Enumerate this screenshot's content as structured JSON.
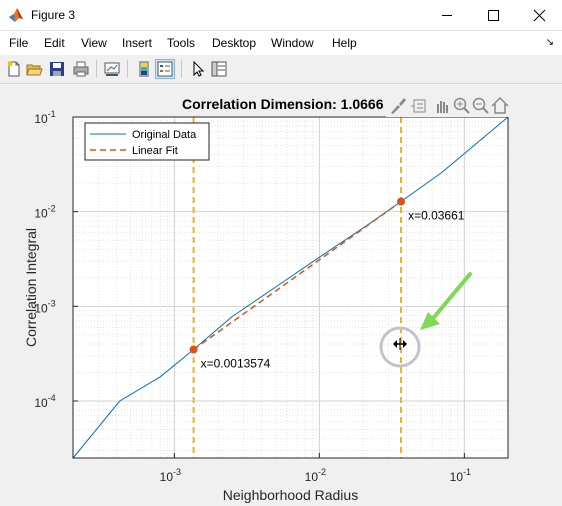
{
  "window": {
    "title": "Figure 3"
  },
  "menu": [
    "File",
    "Edit",
    "View",
    "Insert",
    "Tools",
    "Desktop",
    "Window",
    "Help"
  ],
  "toolbar": {
    "buttons": [
      "new-figure-icon",
      "open-file-icon",
      "save-icon",
      "print-icon",
      "link-plot-icon",
      "insert-colorbar-icon",
      "insert-legend-icon",
      "edit-plot-arrow-icon",
      "property-inspector-icon"
    ]
  },
  "axes_toolbar": [
    "brush-icon",
    "data-tips-icon",
    "pan-icon",
    "zoom-in-icon",
    "zoom-out-icon",
    "home-icon"
  ],
  "chart_data": {
    "type": "line",
    "title": "Correlation Dimension: 1.0666",
    "xlabel": "Neighborhood Radius",
    "ylabel": "Correlation Integral",
    "xscale": "log",
    "yscale": "log",
    "xlim": [
      0.0002,
      0.2
    ],
    "ylim": [
      2.5e-05,
      0.1
    ],
    "grid": true,
    "legend_position": "top-left",
    "x_tick_labels": [
      {
        "value": 0.001,
        "base": "10",
        "exp": "-3"
      },
      {
        "value": 0.01,
        "base": "10",
        "exp": "-2"
      },
      {
        "value": 0.1,
        "base": "10",
        "exp": "-1"
      }
    ],
    "y_tick_labels": [
      {
        "value": 0.0001,
        "base": "10",
        "exp": "-4"
      },
      {
        "value": 0.001,
        "base": "10",
        "exp": "-3"
      },
      {
        "value": 0.01,
        "base": "10",
        "exp": "-2"
      },
      {
        "value": 0.1,
        "base": "10",
        "exp": "-1"
      }
    ],
    "series": [
      {
        "name": "Original Data",
        "color": "#0072bd",
        "style": "solid",
        "x": [
          0.0002,
          0.00042,
          0.0008,
          0.0013574,
          0.0025,
          0.005,
          0.01,
          0.02,
          0.03661,
          0.07,
          0.2
        ],
        "y": [
          2.5e-05,
          0.0001,
          0.00018,
          0.00035,
          0.00078,
          0.0016,
          0.0033,
          0.0067,
          0.0128,
          0.026,
          0.1
        ]
      },
      {
        "name": "Linear Fit",
        "color": "#d95319",
        "style": "dashed",
        "x": [
          0.0013574,
          0.03661
        ],
        "y": [
          0.00035,
          0.0128
        ]
      }
    ],
    "vertical_lines": [
      {
        "x": 0.0013574,
        "color": "#edb120"
      },
      {
        "x": 0.03661,
        "color": "#edb120"
      }
    ],
    "markers": [
      {
        "x": 0.0013574,
        "y": 0.00035,
        "label": "x=0.0013574",
        "color": "#d95319"
      },
      {
        "x": 0.03661,
        "y": 0.0128,
        "label": "x=0.03661",
        "color": "#d95319"
      }
    ]
  },
  "annotation": {
    "arrow_color": "#7ed957",
    "cursor": "resize-horizontal-cursor"
  }
}
